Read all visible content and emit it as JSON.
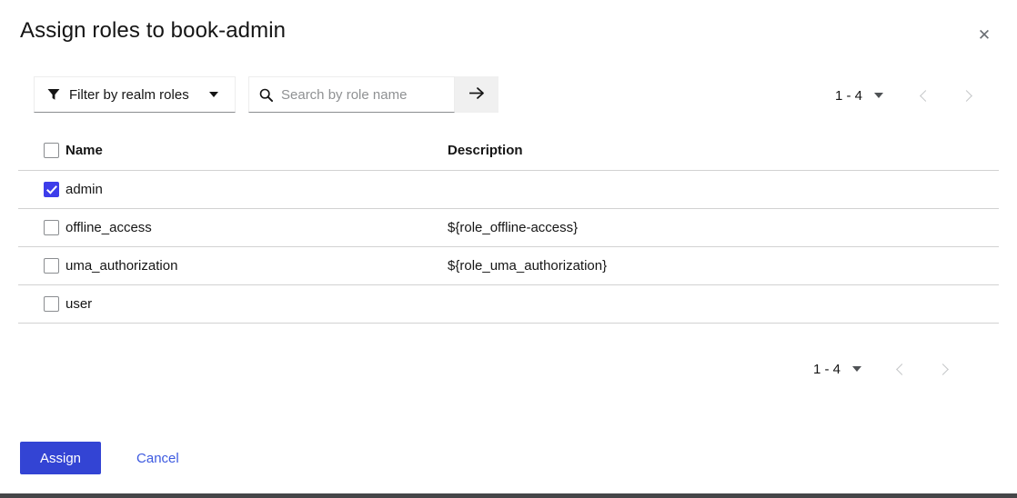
{
  "dialog": {
    "title": "Assign roles to book-admin",
    "close_icon": "close-icon",
    "close_label": "✕"
  },
  "toolbar": {
    "filter": {
      "icon": "funnel-icon",
      "label": "Filter by realm roles",
      "caret_icon": "chevron-down-icon"
    },
    "search": {
      "icon": "search-icon",
      "placeholder": "Search by role name",
      "value": "",
      "submit_icon": "arrow-right-icon"
    }
  },
  "pagination_top": {
    "range": "1 - 4",
    "caret_icon": "chevron-down-icon",
    "prev_icon": "chevron-left-icon",
    "next_icon": "chevron-right-icon"
  },
  "pagination_bottom": {
    "range": "1 - 4",
    "caret_icon": "chevron-down-icon",
    "prev_icon": "chevron-left-icon",
    "next_icon": "chevron-right-icon"
  },
  "table": {
    "select_all_checked": false,
    "columns": {
      "name": "Name",
      "description": "Description"
    },
    "rows": [
      {
        "checked": true,
        "name": "admin",
        "description": ""
      },
      {
        "checked": false,
        "name": "offline_access",
        "description": "${role_offline-access}"
      },
      {
        "checked": false,
        "name": "uma_authorization",
        "description": "${role_uma_authorization}"
      },
      {
        "checked": false,
        "name": "user",
        "description": ""
      }
    ]
  },
  "footer": {
    "assign_label": "Assign",
    "cancel_label": "Cancel"
  },
  "colors": {
    "accent": "#3344d4",
    "checkbox_checked": "#3d3dea",
    "link": "#3d5ae0",
    "bottom_bar": "#454648"
  }
}
